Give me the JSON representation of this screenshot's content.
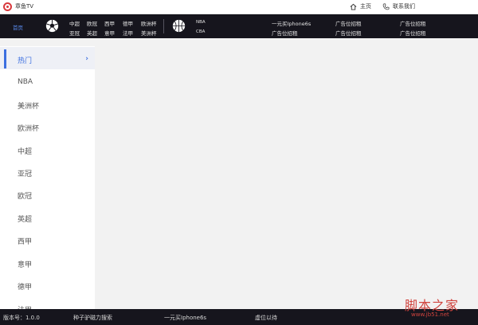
{
  "app": {
    "title": "章鱼TV"
  },
  "titlebar": {
    "home_label": "主页",
    "contact_label": "联系我们"
  },
  "header": {
    "home_tab": "首页",
    "football_leagues": [
      [
        "中超",
        "亚冠"
      ],
      [
        "欧冠",
        "英超"
      ],
      [
        "西甲",
        "意甲"
      ],
      [
        "德甲",
        "法甲"
      ],
      [
        "欧洲杯",
        "美洲杯"
      ]
    ],
    "basketball_leagues": [
      "NBA",
      "CBA"
    ],
    "ads": [
      [
        "一元买Iphone6s",
        "广告位招租"
      ],
      [
        "广告位招租",
        "广告位招租"
      ],
      [
        "广告位招租",
        "广告位招租"
      ]
    ]
  },
  "sidebar": {
    "items": [
      {
        "label": "热门",
        "active": true
      },
      {
        "label": "NBA"
      },
      {
        "label": "美洲杯"
      },
      {
        "label": "欧洲杯"
      },
      {
        "label": "中超"
      },
      {
        "label": "亚冠"
      },
      {
        "label": "欧冠"
      },
      {
        "label": "英超"
      },
      {
        "label": "西甲"
      },
      {
        "label": "意甲"
      },
      {
        "label": "德甲"
      },
      {
        "label": "法甲"
      }
    ],
    "chevron": "›"
  },
  "footer": {
    "version": "版本号：1.0.0",
    "link1": "种子驴磁力搜索",
    "link2": "一元买Iphone6s",
    "link3": "虚位以待"
  },
  "watermark": {
    "main": "脚本之家",
    "sub": "www.jb51.net"
  },
  "colors": {
    "accent": "#3c6fe0",
    "header_bg": "#16151d",
    "brand": "#d9393d"
  }
}
